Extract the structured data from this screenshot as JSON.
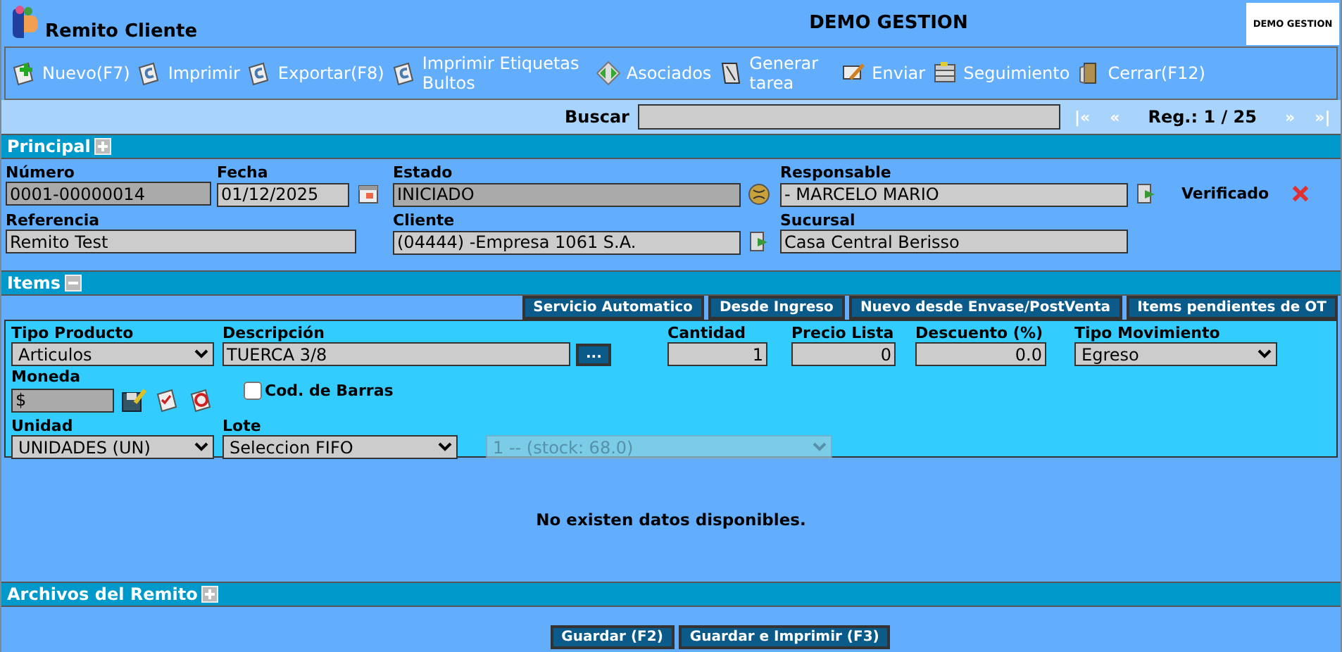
{
  "header": {
    "title": "Remito Cliente",
    "company": "DEMO GESTION",
    "logo_text": "DEMO GESTION"
  },
  "toolbar": [
    {
      "label": "Nuevo(F7)"
    },
    {
      "label": "Imprimir"
    },
    {
      "label": "Exportar(F8)"
    },
    {
      "label": "Imprimir Etiquetas Bultos"
    },
    {
      "label": "Asociados"
    },
    {
      "label": "Generar tarea"
    },
    {
      "label": "Enviar"
    },
    {
      "label": "Seguimiento"
    },
    {
      "label": "Cerrar(F12)"
    }
  ],
  "search": {
    "label": "Buscar"
  },
  "pager": {
    "first": "|«",
    "prev": "«",
    "record": "Reg.: 1 / 25",
    "next": "»",
    "last": "»|"
  },
  "principal": {
    "title": "Principal",
    "expanded": false,
    "fields": [
      {
        "label": "Número",
        "value": "0001-00000014",
        "readonly": true
      },
      {
        "label": "Fecha",
        "value": "01/12/2025",
        "readonly": false
      },
      {
        "label": "Estado",
        "value": "INICIADO",
        "readonly": true
      },
      {
        "label": "Responsable",
        "value": "- MARCELO MARIO",
        "readonly": false
      },
      {
        "label": "Referencia",
        "value": "Remito Test",
        "readonly": false
      },
      {
        "label": "Cliente",
        "value": "(04444) -Empresa 1061 S.A.",
        "readonly": false
      },
      {
        "label": "Sucursal",
        "value": "Casa Central Berisso",
        "readonly": false
      }
    ],
    "verified": {
      "label": "Verificado",
      "checked": false
    }
  },
  "items": {
    "title": "Items",
    "expanded": true,
    "actions": [
      "Servicio Automatico",
      "Desde Ingreso",
      "Nuevo desde Envase/PostVenta",
      "Items pendientes de OT"
    ],
    "row1": [
      {
        "kind": "select",
        "label": "Tipo Producto",
        "value": "Articulos"
      },
      {
        "kind": "text",
        "label": "Descripción",
        "value": "TUERCA 3/8",
        "button": "..."
      },
      {
        "kind": "number",
        "label": "Cantidad",
        "value": "1"
      },
      {
        "kind": "number",
        "label": "Precio Lista",
        "value": "0"
      },
      {
        "kind": "number",
        "label": "Descuento (%)",
        "value": "0.0"
      },
      {
        "kind": "select",
        "label": "Tipo Movimiento",
        "value": "Egreso"
      }
    ],
    "currency": {
      "label": "Moneda",
      "value": "$"
    },
    "barcode": {
      "label": "Cod. de Barras",
      "checked": false
    },
    "row3": [
      {
        "kind": "select",
        "label": "Unidad",
        "value": "UNIDADES (UN)",
        "disabled": false
      },
      {
        "kind": "select",
        "label": "Lote",
        "value": "Seleccion FIFO",
        "disabled": false
      },
      {
        "kind": "select",
        "value": "1 -- (stock: 68.0)",
        "disabled": true
      }
    ],
    "empty_message": "No existen datos disponibles."
  },
  "files": {
    "title": "Archivos del Remito",
    "expanded": false
  },
  "footer_buttons": [
    "Guardar (F2)",
    "Guardar e Imprimir (F3)"
  ]
}
